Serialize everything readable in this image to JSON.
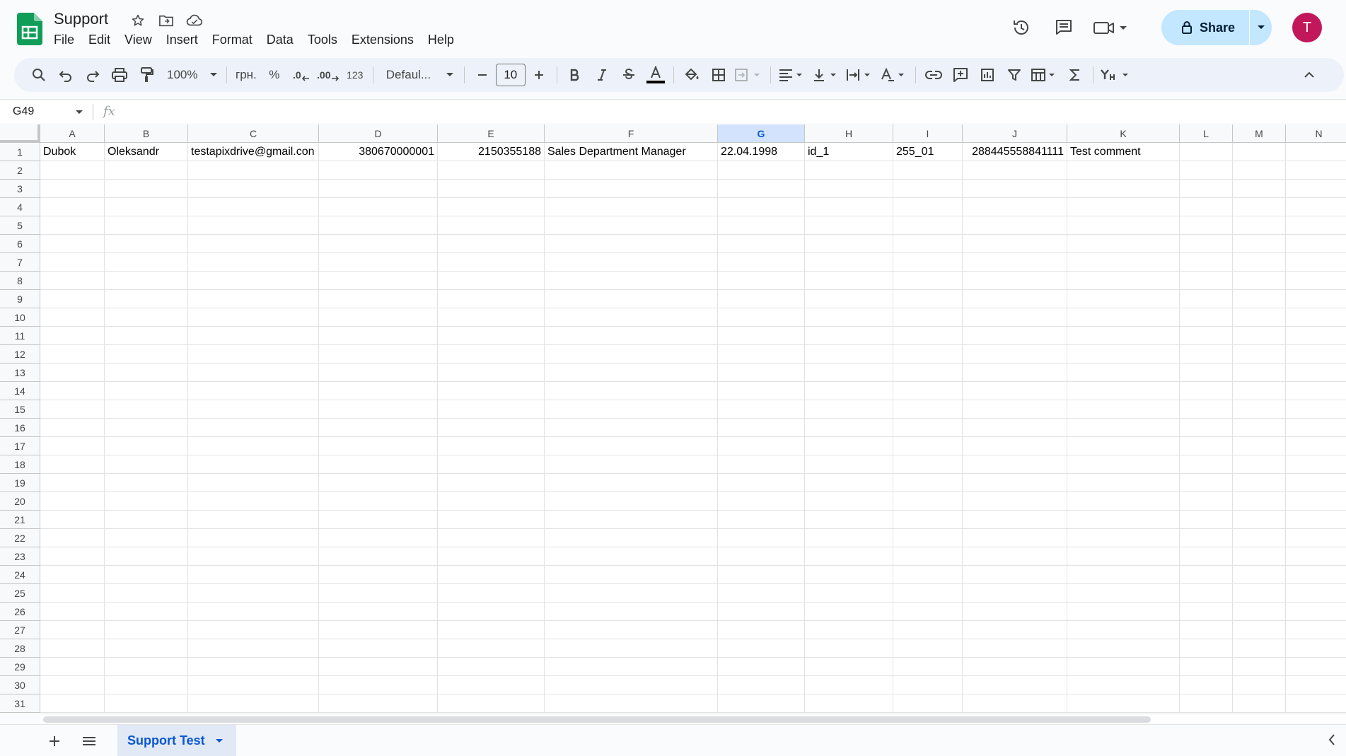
{
  "app": {
    "title": "Support",
    "menu": [
      "File",
      "Edit",
      "View",
      "Insert",
      "Format",
      "Data",
      "Tools",
      "Extensions",
      "Help"
    ],
    "share_label": "Share",
    "avatar_initial": "T",
    "brand_color": "#0f9d58"
  },
  "toolbar": {
    "zoom": "100%",
    "currency": "грн.",
    "percent": "%",
    "decrease_decimal": ".0",
    "increase_decimal": ".00",
    "number_format": "123",
    "font": "Defaul...",
    "font_size": "10",
    "icons": [
      "search-icon",
      "undo-icon",
      "redo-icon",
      "print-icon",
      "paint-format-icon",
      "bold-icon",
      "italic-icon",
      "strikethrough-icon",
      "text-color-icon",
      "fill-color-icon",
      "borders-icon",
      "merge-icon",
      "align-icon",
      "valign-icon",
      "wrap-icon",
      "rotate-icon",
      "link-icon",
      "comment-icon",
      "chart-icon",
      "filter-icon",
      "table-views-icon",
      "functions-icon",
      "input-tools-icon",
      "collapse-icon"
    ]
  },
  "formula_bar": {
    "name_box": "G49",
    "fx": "fx",
    "content": ""
  },
  "grid": {
    "columns": [
      "A",
      "B",
      "C",
      "D",
      "E",
      "F",
      "G",
      "H",
      "I",
      "J",
      "K",
      "L",
      "M",
      "N"
    ],
    "selected_column": "G",
    "row_count": 31,
    "rows": [
      {
        "row": 1,
        "cells": [
          {
            "col": "A",
            "value": "Dubok",
            "align": "left"
          },
          {
            "col": "B",
            "value": "Oleksandr",
            "align": "left"
          },
          {
            "col": "C",
            "value": "testapixdrive@gmail.con",
            "align": "left"
          },
          {
            "col": "D",
            "value": "380670000001",
            "align": "right"
          },
          {
            "col": "E",
            "value": "2150355188",
            "align": "right"
          },
          {
            "col": "F",
            "value": "Sales Department Manager",
            "align": "left"
          },
          {
            "col": "G",
            "value": "22.04.1998",
            "align": "left"
          },
          {
            "col": "H",
            "value": "id_1",
            "align": "left"
          },
          {
            "col": "I",
            "value": "255_01",
            "align": "left"
          },
          {
            "col": "J",
            "value": "288445558841111",
            "align": "right"
          },
          {
            "col": "K",
            "value": "Test comment",
            "align": "left"
          }
        ]
      }
    ]
  },
  "sheets": {
    "active": "Support Test",
    "tabs": [
      "Support Test"
    ]
  }
}
